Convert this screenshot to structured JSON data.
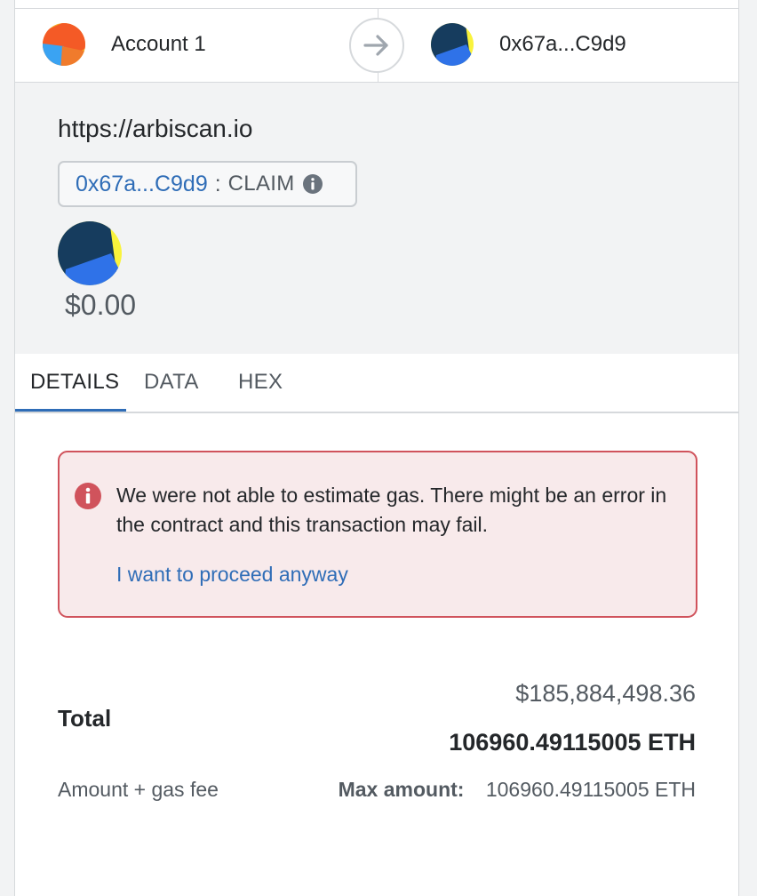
{
  "header": {
    "from_account_name": "Account 1",
    "from_avatar_icon": "jazzicon-avatar-icon",
    "arrow_icon": "arrow-right-icon",
    "to_account_name": "0x67a...C9d9",
    "to_avatar_icon": "jazzicon-avatar-icon"
  },
  "summary": {
    "origin": "https://arbiscan.io",
    "method": {
      "address": "0x67a...C9d9",
      "separator": ":",
      "name": "CLAIM",
      "info_icon": "info-icon"
    },
    "value": "$0.00"
  },
  "tabs": [
    {
      "label": "DETAILS",
      "active": true
    },
    {
      "label": "DATA",
      "active": false
    },
    {
      "label": "HEX",
      "active": false
    }
  ],
  "error": {
    "icon": "error-icon",
    "message": "We were not able to estimate gas. There might be an error in the contract and this transaction may fail.",
    "proceed_link": "I want to proceed anyway"
  },
  "totals": {
    "fiat_total": "$185,884,498.36",
    "label": "Total",
    "eth_total": "106960.49115005 ETH",
    "subtitle": "Amount + gas fee",
    "max_label": "Max amount:",
    "max_value": "106960.49115005 ETH"
  },
  "colors": {
    "accent_blue": "#2f6db7",
    "error_red": "#d0535c",
    "error_bg": "#f8eaeb",
    "text_primary": "#24272a",
    "text_secondary": "#535a61"
  }
}
